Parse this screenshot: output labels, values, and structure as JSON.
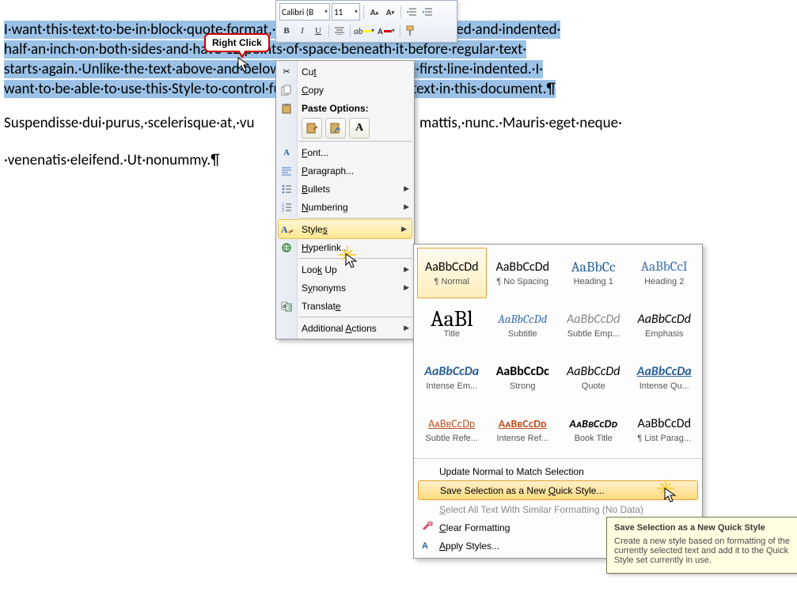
{
  "document": {
    "line1": "I·want·this·text·to·be·in·block·quote·format,·meaning·it·will·be·single-spaced·and·indented·",
    "line2": "half·an·inch·on·both·sides·and·have·12·points·of·space·beneath·it·before·regular·text·",
    "line3": "starts·again.·Unlike·the·text·above·and·below·it,·it·will·not·have·the·first·line·indented.·I·",
    "line4": "want·to·be·able·to·use·this·Style·to·control·future·bits·of·indented·text·in·this·document.¶",
    "line5_a": "Suspendisse·dui·purus,·scelerisque·at,·vu",
    "line5_b": "mattis,·nunc.·Mauris·eget·neque·",
    "line6": "·venenatis·eleifend.·Ut·nonummy.¶"
  },
  "callout": {
    "label": "Right Click"
  },
  "mini_toolbar": {
    "font": "Calibri (B",
    "size": "11"
  },
  "context_menu": {
    "cut": "Cut",
    "copy": "Copy",
    "paste_header": "Paste Options:",
    "font": "Font...",
    "paragraph": "Paragraph...",
    "bullets": "Bullets",
    "numbering": "Numbering",
    "styles": "Styles",
    "hyperlink": "Hyperlink...",
    "lookup": "Look Up",
    "synonyms": "Synonyms",
    "translate": "Translate",
    "additional": "Additional Actions"
  },
  "styles_gallery": {
    "styles": [
      {
        "preview": "AaBbCcDd",
        "name": "¶ Normal",
        "pstyle": "font-family:Calibri;color:#000;"
      },
      {
        "preview": "AaBbCcDd",
        "name": "¶ No Spacing",
        "pstyle": "font-family:Calibri;color:#000;"
      },
      {
        "preview": "AaBbCc",
        "name": "Heading 1",
        "pstyle": "font-family:Cambria;color:#2a6099;font-size:18px;"
      },
      {
        "preview": "AaBbCcI",
        "name": "Heading 2",
        "pstyle": "font-family:Cambria;color:#3a70b0;font-size:17px;"
      },
      {
        "preview": "AaBl",
        "name": "Title",
        "pstyle": "font-family:Cambria;color:#000;font-size:28px;"
      },
      {
        "preview": "AaBbCcDd",
        "name": "Subtitle",
        "pstyle": "font-family:Cambria;color:#3a70b0;font-style:italic;font-size:15px;"
      },
      {
        "preview": "AaBbCcDd",
        "name": "Subtle Emp...",
        "pstyle": "font-family:Calibri;color:#888;font-style:italic;"
      },
      {
        "preview": "AaBbCcDd",
        "name": "Emphasis",
        "pstyle": "font-family:Calibri;color:#000;font-style:italic;"
      },
      {
        "preview": "AaBbCcDa",
        "name": "Intense Em...",
        "pstyle": "font-family:Calibri;color:#2a6099;font-style:italic;font-weight:bold;"
      },
      {
        "preview": "AaBbCcDc",
        "name": "Strong",
        "pstyle": "font-family:Calibri;color:#000;font-weight:bold;"
      },
      {
        "preview": "AaBbCcDd",
        "name": "Quote",
        "pstyle": "font-family:Calibri;color:#000;font-style:italic;"
      },
      {
        "preview": "AaBbCcDa",
        "name": "Intense Qu...",
        "pstyle": "font-family:Calibri;color:#2a6099;font-style:italic;font-weight:bold;text-decoration:underline;"
      },
      {
        "preview": "AᴀBʙCᴄDᴅ",
        "name": "Subtle Refe...",
        "pstyle": "font-family:Calibri;color:#c05020;text-decoration:underline;font-size:14px;font-variant:small-caps;"
      },
      {
        "preview": "AᴀBʙCᴄDᴅ",
        "name": "Intense Ref...",
        "pstyle": "font-family:Calibri;color:#c05020;text-decoration:underline;font-weight:bold;font-size:14px;font-variant:small-caps;"
      },
      {
        "preview": "AᴀBʙCᴄDᴅ",
        "name": "Book Title",
        "pstyle": "font-family:Calibri;color:#000;font-weight:bold;font-style:italic;font-variant:small-caps;font-size:14px;"
      },
      {
        "preview": "AaBbCcDd",
        "name": "¶ List Parag...",
        "pstyle": "font-family:Calibri;color:#000;"
      }
    ],
    "update": "Update Normal to Match Selection",
    "save_new": "Save Selection as a New Quick Style...",
    "select_similar": "Select All Text With Similar Formatting (No Data)",
    "clear": "Clear Formatting",
    "apply": "Apply Styles..."
  },
  "tooltip": {
    "title": "Save Selection as a New Quick Style",
    "body": "Create a new style based on formatting of the currently selected text and add it to the Quick Style set currently in use."
  }
}
